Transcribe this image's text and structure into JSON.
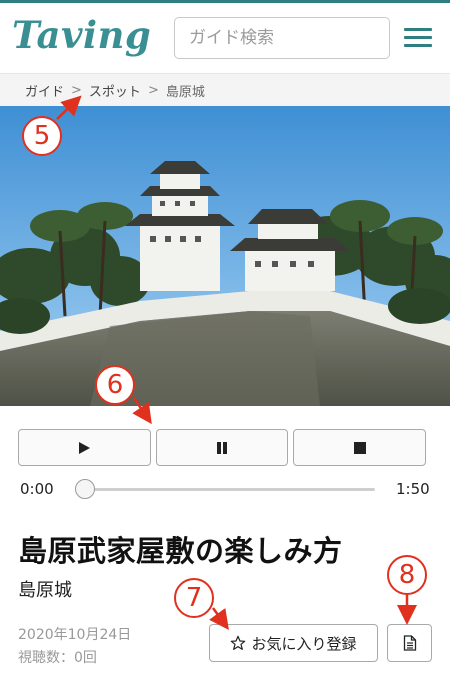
{
  "header": {
    "logo_text": "Taving",
    "search_placeholder": "ガイド検索"
  },
  "breadcrumb": {
    "items": [
      "ガイド",
      "スポット",
      "島原城"
    ],
    "separator": ">"
  },
  "player": {
    "time_start": "0:00",
    "time_end": "1:50",
    "progress": 0
  },
  "article": {
    "title": "島原武家屋敷の楽しみ方",
    "subtitle": "島原城",
    "date": "2020年10月24日",
    "views": "視聴数：0回",
    "favorite_label": "お気に入り登録"
  },
  "annotations": {
    "n5": "5",
    "n6": "6",
    "n7": "7",
    "n8": "8"
  },
  "colors": {
    "brand": "#3a8f92",
    "annotation": "#e0301e"
  }
}
